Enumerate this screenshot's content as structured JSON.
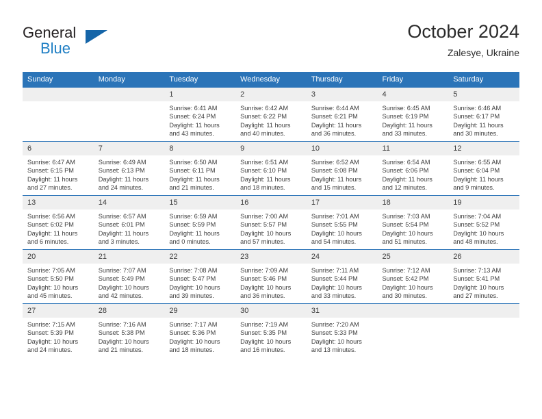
{
  "logo": {
    "word_top": "General",
    "word_bottom": "Blue",
    "triangle_color": "#1565a8",
    "blue_text_color": "#1f7fc4"
  },
  "header": {
    "title": "October 2024",
    "subtitle": "Zalesye, Ukraine"
  },
  "theme": {
    "header_blue": "#2b74b8",
    "daynum_gray": "#efefef",
    "text": "#3c3c3c"
  },
  "weekday_headers": [
    "Sunday",
    "Monday",
    "Tuesday",
    "Wednesday",
    "Thursday",
    "Friday",
    "Saturday"
  ],
  "labels": {
    "sunrise_prefix": "Sunrise:",
    "sunset_prefix": "Sunset:",
    "daylight_prefix": "Daylight:"
  },
  "weeks": [
    [
      {
        "day": "",
        "empty": true
      },
      {
        "day": "",
        "empty": true
      },
      {
        "day": "1",
        "sunrise": "Sunrise: 6:41 AM",
        "sunset": "Sunset: 6:24 PM",
        "daylight_1": "Daylight: 11 hours",
        "daylight_2": "and 43 minutes."
      },
      {
        "day": "2",
        "sunrise": "Sunrise: 6:42 AM",
        "sunset": "Sunset: 6:22 PM",
        "daylight_1": "Daylight: 11 hours",
        "daylight_2": "and 40 minutes."
      },
      {
        "day": "3",
        "sunrise": "Sunrise: 6:44 AM",
        "sunset": "Sunset: 6:21 PM",
        "daylight_1": "Daylight: 11 hours",
        "daylight_2": "and 36 minutes."
      },
      {
        "day": "4",
        "sunrise": "Sunrise: 6:45 AM",
        "sunset": "Sunset: 6:19 PM",
        "daylight_1": "Daylight: 11 hours",
        "daylight_2": "and 33 minutes."
      },
      {
        "day": "5",
        "sunrise": "Sunrise: 6:46 AM",
        "sunset": "Sunset: 6:17 PM",
        "daylight_1": "Daylight: 11 hours",
        "daylight_2": "and 30 minutes."
      }
    ],
    [
      {
        "day": "6",
        "sunrise": "Sunrise: 6:47 AM",
        "sunset": "Sunset: 6:15 PM",
        "daylight_1": "Daylight: 11 hours",
        "daylight_2": "and 27 minutes."
      },
      {
        "day": "7",
        "sunrise": "Sunrise: 6:49 AM",
        "sunset": "Sunset: 6:13 PM",
        "daylight_1": "Daylight: 11 hours",
        "daylight_2": "and 24 minutes."
      },
      {
        "day": "8",
        "sunrise": "Sunrise: 6:50 AM",
        "sunset": "Sunset: 6:11 PM",
        "daylight_1": "Daylight: 11 hours",
        "daylight_2": "and 21 minutes."
      },
      {
        "day": "9",
        "sunrise": "Sunrise: 6:51 AM",
        "sunset": "Sunset: 6:10 PM",
        "daylight_1": "Daylight: 11 hours",
        "daylight_2": "and 18 minutes."
      },
      {
        "day": "10",
        "sunrise": "Sunrise: 6:52 AM",
        "sunset": "Sunset: 6:08 PM",
        "daylight_1": "Daylight: 11 hours",
        "daylight_2": "and 15 minutes."
      },
      {
        "day": "11",
        "sunrise": "Sunrise: 6:54 AM",
        "sunset": "Sunset: 6:06 PM",
        "daylight_1": "Daylight: 11 hours",
        "daylight_2": "and 12 minutes."
      },
      {
        "day": "12",
        "sunrise": "Sunrise: 6:55 AM",
        "sunset": "Sunset: 6:04 PM",
        "daylight_1": "Daylight: 11 hours",
        "daylight_2": "and 9 minutes."
      }
    ],
    [
      {
        "day": "13",
        "sunrise": "Sunrise: 6:56 AM",
        "sunset": "Sunset: 6:02 PM",
        "daylight_1": "Daylight: 11 hours",
        "daylight_2": "and 6 minutes."
      },
      {
        "day": "14",
        "sunrise": "Sunrise: 6:57 AM",
        "sunset": "Sunset: 6:01 PM",
        "daylight_1": "Daylight: 11 hours",
        "daylight_2": "and 3 minutes."
      },
      {
        "day": "15",
        "sunrise": "Sunrise: 6:59 AM",
        "sunset": "Sunset: 5:59 PM",
        "daylight_1": "Daylight: 11 hours",
        "daylight_2": "and 0 minutes."
      },
      {
        "day": "16",
        "sunrise": "Sunrise: 7:00 AM",
        "sunset": "Sunset: 5:57 PM",
        "daylight_1": "Daylight: 10 hours",
        "daylight_2": "and 57 minutes."
      },
      {
        "day": "17",
        "sunrise": "Sunrise: 7:01 AM",
        "sunset": "Sunset: 5:55 PM",
        "daylight_1": "Daylight: 10 hours",
        "daylight_2": "and 54 minutes."
      },
      {
        "day": "18",
        "sunrise": "Sunrise: 7:03 AM",
        "sunset": "Sunset: 5:54 PM",
        "daylight_1": "Daylight: 10 hours",
        "daylight_2": "and 51 minutes."
      },
      {
        "day": "19",
        "sunrise": "Sunrise: 7:04 AM",
        "sunset": "Sunset: 5:52 PM",
        "daylight_1": "Daylight: 10 hours",
        "daylight_2": "and 48 minutes."
      }
    ],
    [
      {
        "day": "20",
        "sunrise": "Sunrise: 7:05 AM",
        "sunset": "Sunset: 5:50 PM",
        "daylight_1": "Daylight: 10 hours",
        "daylight_2": "and 45 minutes."
      },
      {
        "day": "21",
        "sunrise": "Sunrise: 7:07 AM",
        "sunset": "Sunset: 5:49 PM",
        "daylight_1": "Daylight: 10 hours",
        "daylight_2": "and 42 minutes."
      },
      {
        "day": "22",
        "sunrise": "Sunrise: 7:08 AM",
        "sunset": "Sunset: 5:47 PM",
        "daylight_1": "Daylight: 10 hours",
        "daylight_2": "and 39 minutes."
      },
      {
        "day": "23",
        "sunrise": "Sunrise: 7:09 AM",
        "sunset": "Sunset: 5:46 PM",
        "daylight_1": "Daylight: 10 hours",
        "daylight_2": "and 36 minutes."
      },
      {
        "day": "24",
        "sunrise": "Sunrise: 7:11 AM",
        "sunset": "Sunset: 5:44 PM",
        "daylight_1": "Daylight: 10 hours",
        "daylight_2": "and 33 minutes."
      },
      {
        "day": "25",
        "sunrise": "Sunrise: 7:12 AM",
        "sunset": "Sunset: 5:42 PM",
        "daylight_1": "Daylight: 10 hours",
        "daylight_2": "and 30 minutes."
      },
      {
        "day": "26",
        "sunrise": "Sunrise: 7:13 AM",
        "sunset": "Sunset: 5:41 PM",
        "daylight_1": "Daylight: 10 hours",
        "daylight_2": "and 27 minutes."
      }
    ],
    [
      {
        "day": "27",
        "sunrise": "Sunrise: 7:15 AM",
        "sunset": "Sunset: 5:39 PM",
        "daylight_1": "Daylight: 10 hours",
        "daylight_2": "and 24 minutes."
      },
      {
        "day": "28",
        "sunrise": "Sunrise: 7:16 AM",
        "sunset": "Sunset: 5:38 PM",
        "daylight_1": "Daylight: 10 hours",
        "daylight_2": "and 21 minutes."
      },
      {
        "day": "29",
        "sunrise": "Sunrise: 7:17 AM",
        "sunset": "Sunset: 5:36 PM",
        "daylight_1": "Daylight: 10 hours",
        "daylight_2": "and 18 minutes."
      },
      {
        "day": "30",
        "sunrise": "Sunrise: 7:19 AM",
        "sunset": "Sunset: 5:35 PM",
        "daylight_1": "Daylight: 10 hours",
        "daylight_2": "and 16 minutes."
      },
      {
        "day": "31",
        "sunrise": "Sunrise: 7:20 AM",
        "sunset": "Sunset: 5:33 PM",
        "daylight_1": "Daylight: 10 hours",
        "daylight_2": "and 13 minutes."
      },
      {
        "day": "",
        "empty": true
      },
      {
        "day": "",
        "empty": true
      }
    ]
  ]
}
